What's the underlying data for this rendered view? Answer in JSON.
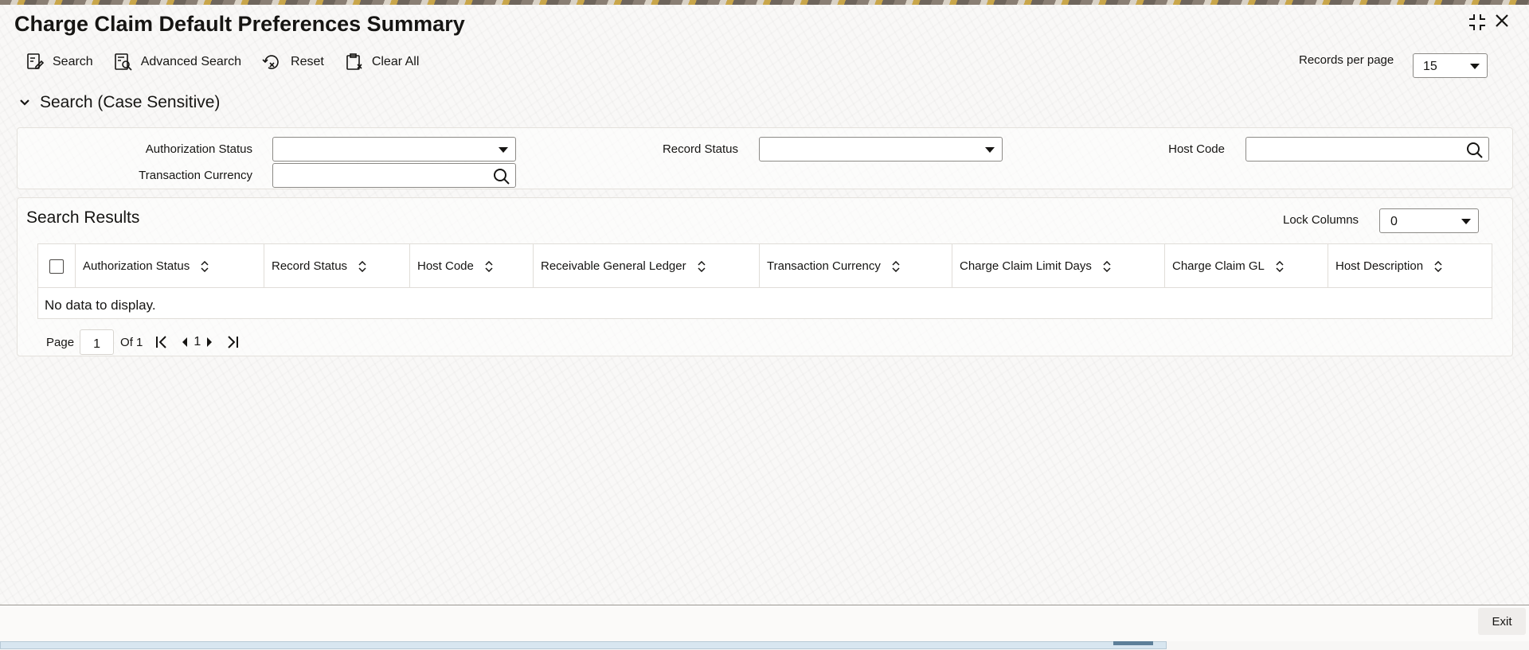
{
  "window": {
    "title": "Charge Claim Default Preferences Summary"
  },
  "toolbar": {
    "search_label": "Search",
    "advanced_search_label": "Advanced Search",
    "reset_label": "Reset",
    "clear_all_label": "Clear All"
  },
  "records_per_page": {
    "label": "Records per page",
    "value": "15"
  },
  "search_section": {
    "header": "Search (Case Sensitive)",
    "fields": {
      "authorization_status": {
        "label": "Authorization Status",
        "value": ""
      },
      "record_status": {
        "label": "Record Status",
        "value": ""
      },
      "host_code": {
        "label": "Host Code",
        "value": ""
      },
      "transaction_currency": {
        "label": "Transaction Currency",
        "value": ""
      }
    }
  },
  "results": {
    "title": "Search Results",
    "lock_columns_label": "Lock Columns",
    "lock_columns_value": "0",
    "columns": [
      "Authorization Status",
      "Record Status",
      "Host Code",
      "Receivable General Ledger",
      "Transaction Currency",
      "Charge Claim Limit Days",
      "Charge Claim GL",
      "Host Description"
    ],
    "empty_message": "No data to display."
  },
  "pagination": {
    "page_label": "Page",
    "current_page": "1",
    "of_label": "Of 1",
    "page_number": "1"
  },
  "footer": {
    "exit_label": "Exit"
  }
}
